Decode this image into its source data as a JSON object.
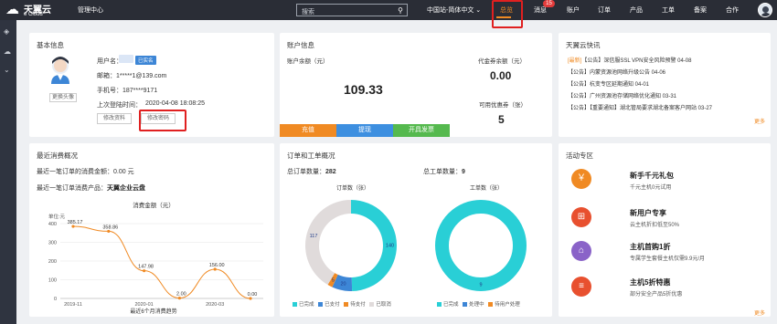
{
  "topbar": {
    "brand_cn": "天翼云",
    "brand_en": "e Cloud",
    "mgmt_center": "管理中心",
    "search_placeholder": "搜索",
    "region": "中国站-简体中文",
    "nav": [
      "总览",
      "消息",
      "账户",
      "订单",
      "产品",
      "工单",
      "备案",
      "合作"
    ],
    "message_badge": "15",
    "accent": "#f08a23"
  },
  "basic": {
    "title": "基本信息",
    "username_label": "用户名：",
    "verified_badge": "已实名",
    "email": "邮箱：1*****1@139.com",
    "phone": "手机号：187****9171",
    "last_login_label": "上次登陆时间：",
    "last_login": "2020-04-08 18:08:25",
    "change_avatar": "更换头像",
    "edit_profile": "修改资料",
    "change_password": "修改密码"
  },
  "account": {
    "title": "账户信息",
    "balance_label": "账户余额（元）",
    "balance": "109.33",
    "voucher_label": "代金券余额（元）",
    "voucher": "0.00",
    "coupon_label": "可用优惠券（张）",
    "coupon": "5",
    "actions": [
      "充值",
      "提现",
      "开具发票"
    ],
    "action_colors": [
      "#f08a23",
      "#3d8fe0",
      "#55b94e"
    ]
  },
  "news": {
    "title": "天翼云快讯",
    "items": [
      {
        "tag": "[最新]",
        "text": "【公告】深信服SSL VPN安全风险预警 04-08"
      },
      {
        "tag": "",
        "text": "【公告】内蒙资源池网络升级公告 04-06"
      },
      {
        "tag": "",
        "text": "【公告】杭变专区延期通知 04-01"
      },
      {
        "tag": "",
        "text": "【公告】广州资源池存储网络优化通知 03-31"
      },
      {
        "tag": "",
        "text": "【公告】【重要通知】湖北管局要求湖北备案客户网站 03-27"
      }
    ],
    "more": "更多"
  },
  "spend": {
    "title": "最近消费概况",
    "last_order_label": "最近一笔订单的消费金额：",
    "last_order_amount": "0.00 元",
    "last_product_label": "最近一笔订单消费产品：",
    "last_product": "天翼企业云盘",
    "chart_title": "消费金额（元）",
    "unit_label": "单位:元",
    "chart_caption": "最近6个月消费趋势"
  },
  "tickets": {
    "title": "订单和工单概况",
    "total_orders_label": "总订单数量：",
    "total_orders": "282",
    "total_tickets_label": "总工单数量：",
    "total_tickets": "9",
    "order_chart_title": "订单数（张）",
    "ticket_chart_title": "工单数（张）",
    "order_legend": [
      "已完成",
      "已支付",
      "待支付",
      "已取消"
    ],
    "ticket_legend": [
      "已完成",
      "处理中",
      "待用户处理"
    ]
  },
  "promo": {
    "title": "活动专区",
    "items": [
      {
        "title": "新手千元礼包",
        "sub": "千元主机0元试用",
        "color": "#f08a23",
        "icon": "coin-icon"
      },
      {
        "title": "新用户专享",
        "sub": "云主机折扣低至50%",
        "color": "#e8502f",
        "icon": "gift-icon"
      },
      {
        "title": "主机首购1折",
        "sub": "专属学生套餐主机仅需9.9元/月",
        "color": "#8a63c8",
        "icon": "shop-icon"
      },
      {
        "title": "主机5折特惠",
        "sub": "部分安全产品5折优惠",
        "color": "#e8502f",
        "icon": "database-icon"
      }
    ],
    "more": "更多"
  },
  "chart_data": [
    {
      "type": "line",
      "title": "消费金额（元）",
      "xlabel": "最近6个月消费趋势",
      "ylabel": "单位:元",
      "categories": [
        "2019-11",
        "2019-12",
        "2020-01",
        "2020-02",
        "2020-03",
        "2020-04"
      ],
      "tick_labels": [
        "2019-11",
        "2020-01",
        "2020-03"
      ],
      "values": [
        385.17,
        358.86,
        147.98,
        2.0,
        156.0,
        0.0
      ],
      "value_labels": [
        "385.17",
        "358.86",
        "147.98",
        "2.00",
        "156.00",
        "0.00"
      ],
      "ylim": [
        0,
        400
      ],
      "yticks": [
        0,
        100,
        200,
        300,
        400
      ],
      "color": "#f08a23"
    },
    {
      "type": "pie",
      "title": "订单数（张）",
      "categories": [
        "已完成",
        "已支付",
        "待支付",
        "已取消"
      ],
      "values": [
        140,
        20,
        5,
        117
      ],
      "colors": [
        "#29cfd6",
        "#3d86d6",
        "#f08a23",
        "#e0dbdb"
      ]
    },
    {
      "type": "pie",
      "title": "工单数（张）",
      "categories": [
        "已完成",
        "处理中",
        "待用户处理"
      ],
      "values": [
        9,
        0,
        0
      ],
      "colors": [
        "#29cfd6",
        "#3d86d6",
        "#f08a23"
      ]
    }
  ]
}
